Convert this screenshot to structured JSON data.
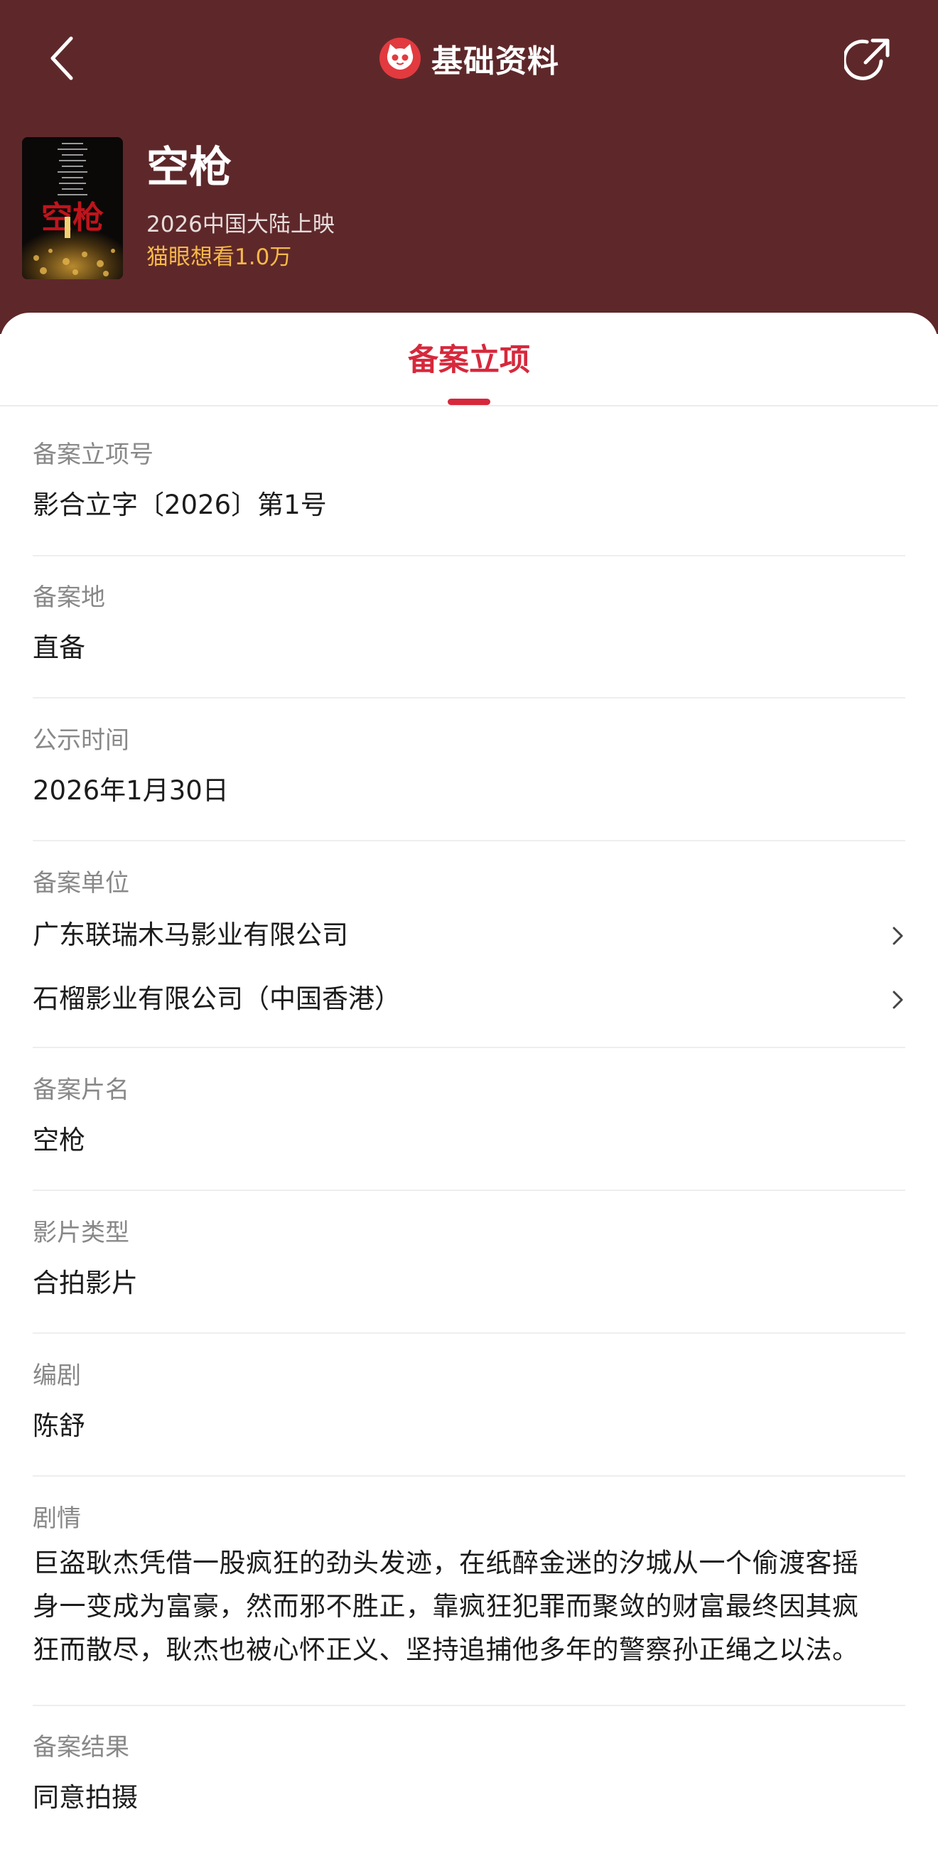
{
  "header": {
    "title": "基础资料",
    "movie_name": "空枪",
    "release_info": "2026中国大陆上映",
    "want_info": "猫眼想看1.0万",
    "poster_title": "空枪"
  },
  "tabs": [
    {
      "label": "备案立项",
      "active": true
    }
  ],
  "fields": {
    "record_no": {
      "label": "备案立项号",
      "value": "影合立字〔2026〕第1号"
    },
    "record_place": {
      "label": "备案地",
      "value": "直备"
    },
    "publish_time": {
      "label": "公示时间",
      "value": "2026年1月30日"
    },
    "record_units": {
      "label": "备案单位",
      "items": [
        "广东联瑞木马影业有限公司",
        "石榴影业有限公司（中国香港）"
      ]
    },
    "record_title": {
      "label": "备案片名",
      "value": "空枪"
    },
    "film_type": {
      "label": "影片类型",
      "value": "合拍影片"
    },
    "screenwriter": {
      "label": "编剧",
      "value": "陈舒"
    },
    "plot": {
      "label": "剧情",
      "lines": [
        "巨盗耿杰凭借一股疯狂的劲头发迹，在纸醉金迷的汐城从一个偷渡客摇",
        "身一变成为富豪，然而邪不胜正，靠疯狂犯罪而聚敛的财富最终因其疯",
        "狂而散尽，耿杰也被心怀正义、坚持追捕他多年的警察孙正绳之以法。"
      ]
    },
    "record_result": {
      "label": "备案结果",
      "value": "同意拍摄"
    }
  },
  "colors": {
    "header_bg": "#5e282a",
    "accent": "#d6283c",
    "want_color": "#f6b94a"
  },
  "icons": [
    "back-arrow-icon",
    "maoyan-cat-logo-icon",
    "share-icon",
    "chevron-right-icon"
  ]
}
